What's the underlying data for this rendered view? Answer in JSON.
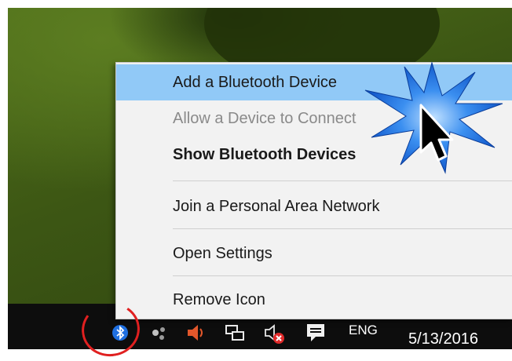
{
  "menu": {
    "items": [
      {
        "label": "Add a Bluetooth Device",
        "state": "highlighted"
      },
      {
        "label": "Allow a Device to Connect",
        "state": "disabled"
      },
      {
        "label": "Show Bluetooth Devices",
        "state": "bold"
      },
      {
        "label": "Join a Personal Area Network",
        "state": "normal"
      },
      {
        "label": "Open Settings",
        "state": "normal"
      },
      {
        "label": "Remove Icon",
        "state": "normal"
      }
    ]
  },
  "taskbar": {
    "language": "ENG",
    "date": "5/13/2016",
    "tray_icons": [
      "bluetooth-icon",
      "network-share-icon",
      "volume-icon",
      "network-icon",
      "muted-speaker-icon",
      "action-center-icon"
    ]
  },
  "colors": {
    "highlight": "#91c9f7",
    "starburst": "#1f78e8",
    "annotation": "#e02020"
  }
}
